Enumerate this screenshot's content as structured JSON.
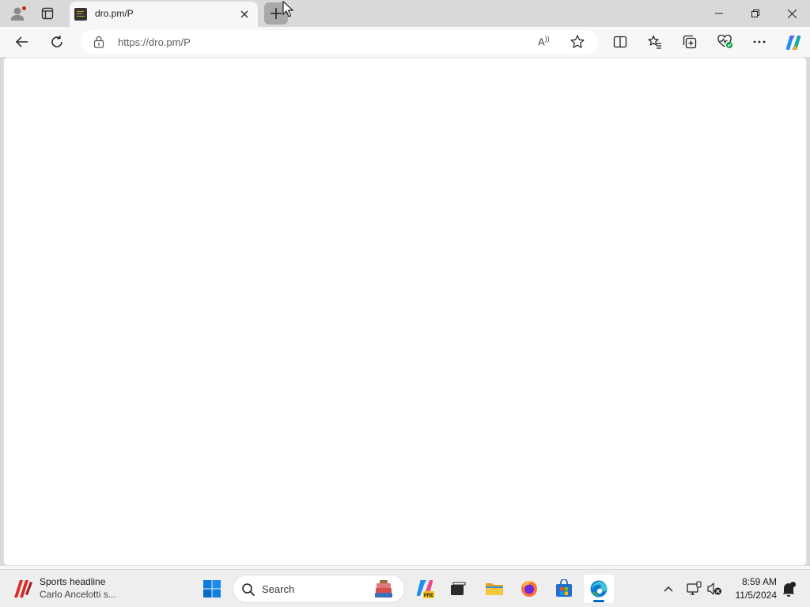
{
  "browser": {
    "tab": {
      "title": "dro.pm/P"
    },
    "address": {
      "url": "https://dro.pm/P"
    },
    "read_aloud_glyph": "A",
    "icons": [
      "profile-icon",
      "tab-actions-icon",
      "close-icon",
      "plus-icon",
      "back-arrow-icon",
      "refresh-icon",
      "lock-icon",
      "read-aloud-icon",
      "favorite-star-icon",
      "split-screen-icon",
      "favorites-icon",
      "collections-icon",
      "browser-essentials-icon",
      "more-icon",
      "copilot-icon",
      "minimize-icon",
      "maximize-icon",
      "window-close-icon"
    ]
  },
  "taskbar": {
    "widget": {
      "headline": "Sports headline",
      "subtext": "Carlo Ancelotti s..."
    },
    "search": {
      "placeholder": "Search"
    },
    "clock": {
      "time": "8:59 AM",
      "date": "11/5/2024"
    },
    "icons": [
      "windows-start-icon",
      "search-icon",
      "copilot-app-icon",
      "task-view-icon",
      "file-explorer-icon",
      "firefox-icon",
      "microsoft-store-icon",
      "edge-icon",
      "chevron-up-icon",
      "network-icon",
      "volume-icon",
      "notification-icon"
    ]
  },
  "colors": {
    "titlebar": "#d9d9d9",
    "toolbar": "#f7f7f7",
    "page": "#ffffff",
    "taskbar": "#eeeeee",
    "accent": "#0067c0",
    "profile_badge": "#c42b1c"
  }
}
